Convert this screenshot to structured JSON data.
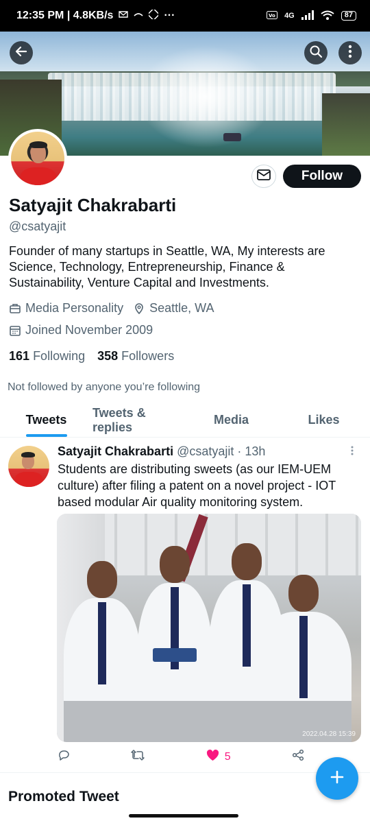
{
  "status_bar": {
    "time_speed": "12:35 PM | 4.8KB/s",
    "network": "4G",
    "battery": "87"
  },
  "profile": {
    "name": "Satyajit Chakrabarti",
    "handle": "@csatyajit",
    "bio": "Founder of many startups in Seattle, WA, My interests are Science, Technology, Entrepreneurship, Finance & Sustainability, Venture Capital and Investments.",
    "category": "Media Personality",
    "location": "Seattle, WA",
    "joined": "Joined November 2009",
    "following_count": "161",
    "following_label": "Following",
    "followers_count": "358",
    "followers_label": "Followers",
    "not_followed": "Not followed by anyone you’re following",
    "follow_label": "Follow"
  },
  "tabs": [
    {
      "label": "Tweets",
      "active": true
    },
    {
      "label": "Tweets & replies",
      "active": false
    },
    {
      "label": "Media",
      "active": false
    },
    {
      "label": "Likes",
      "active": false
    }
  ],
  "tweet": {
    "author": "Satyajit Chakrabarti",
    "handle": "@csatyajit",
    "time": "· 13h",
    "text": "Students are distributing sweets (as our IEM-UEM culture) after filing a patent on a novel project - IOT based modular Air quality monitoring system.",
    "photo_timestamp": "2022.04.28 15:39",
    "like_count": "5"
  },
  "promoted_label": "Promoted Tweet",
  "colors": {
    "accent": "#1d9bf0",
    "like": "#f91880",
    "text": "#0f1419",
    "muted": "#536471"
  }
}
